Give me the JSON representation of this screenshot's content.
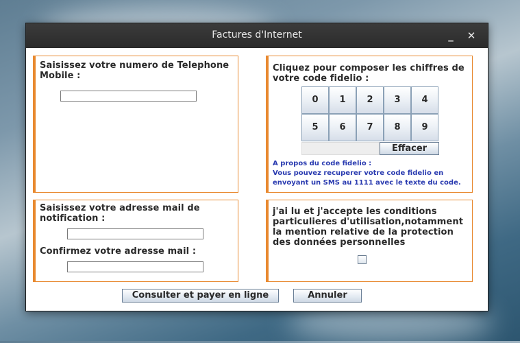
{
  "window": {
    "title": "Factures d'Internet",
    "minimize_icon": "minimize-icon",
    "close_icon": "close-icon"
  },
  "phone_panel": {
    "label": "Saisissez votre numero de Telephone Mobile :",
    "value": ""
  },
  "fidelio_panel": {
    "label": "Cliquez pour composer les chiffres de votre code fidelio :",
    "keys": [
      "0",
      "1",
      "2",
      "3",
      "4",
      "5",
      "6",
      "7",
      "8",
      "9"
    ],
    "clear_label": "Effacer",
    "info_title": "A propos du code fidelio :",
    "info_text": "Vous pouvez recuperer votre code fidelio en envoyant un SMS au 1111 avec le texte du code."
  },
  "email_panel": {
    "label": "Saisissez votre adresse mail de notification :",
    "confirm_label": "Confirmez votre adresse mail :",
    "email_value": "",
    "confirm_value": ""
  },
  "terms_panel": {
    "label": "j'ai lu et j'accepte les conditions particulieres d'utilisation,notamment la mention relative de la protection des données personnelles",
    "checked": false
  },
  "actions": {
    "submit_label": "Consulter et payer en ligne",
    "cancel_label": "Annuler"
  },
  "colors": {
    "panel_border": "#e8892f",
    "info_text": "#2a3bb0",
    "titlebar": "#2f2f2f"
  }
}
